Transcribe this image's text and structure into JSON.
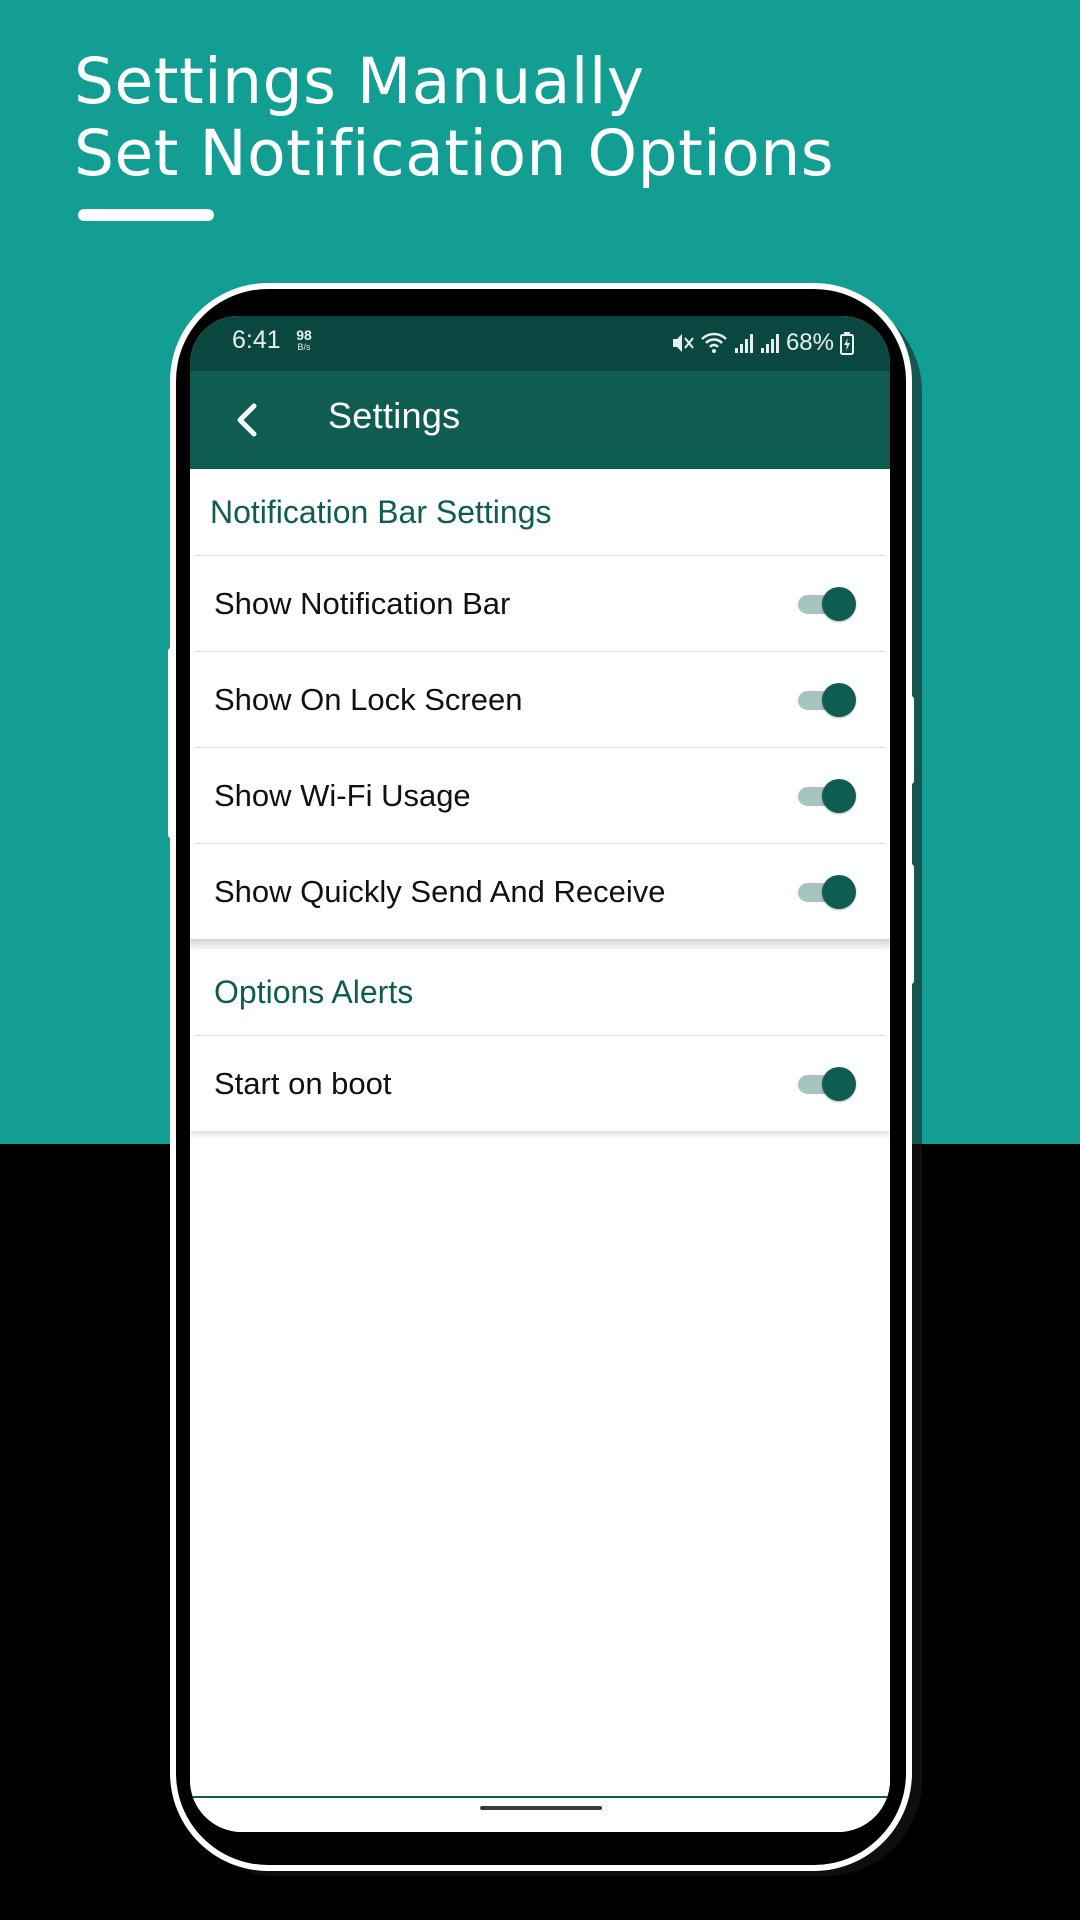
{
  "promo": {
    "title_line1": "Settings Manually",
    "title_line2": "Set Notification Options"
  },
  "status_bar": {
    "time": "6:41",
    "speed_value": "98",
    "speed_unit": "B/s",
    "battery_percent": "68%",
    "icons": [
      "mute-vibrate-icon",
      "wifi-icon",
      "signal-icon",
      "signal-icon",
      "battery-charging-icon"
    ]
  },
  "app_bar": {
    "title": "Settings",
    "back_icon": "chevron-left-icon"
  },
  "sections": [
    {
      "header": "Notification Bar Settings",
      "items": [
        {
          "label": "Show Notification Bar",
          "on": true
        },
        {
          "label": "Show On Lock Screen",
          "on": true
        },
        {
          "label": "Show Wi-Fi Usage",
          "on": true
        },
        {
          "label": "Show Quickly Send And Receive",
          "on": true
        }
      ]
    },
    {
      "header": "Options Alerts",
      "items": [
        {
          "label": "Start on boot",
          "on": true
        }
      ]
    }
  ],
  "colors": {
    "teal_background": "#139e93",
    "app_bar": "#0f5c53",
    "status_bar": "#0a4741",
    "toggle_thumb": "#0f5c53",
    "toggle_track": "#a6c3bf"
  }
}
